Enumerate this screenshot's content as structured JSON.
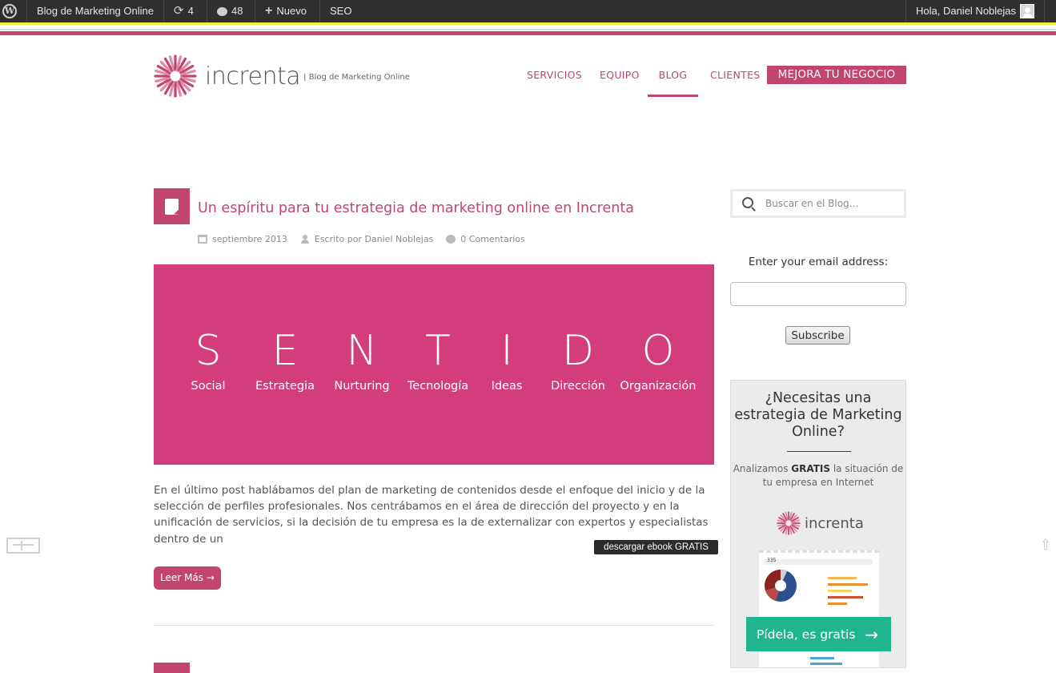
{
  "adminbar": {
    "site_name": "Blog de Marketing Online",
    "updates_count": "4",
    "comments_count": "48",
    "new_label": "Nuevo",
    "seo_label": "SEO",
    "greeting": "Hola, Daniel Noblejas",
    "wp_glyph": "W",
    "update_glyph": "⟳",
    "comment_glyph": "💬",
    "plus_glyph": "+"
  },
  "header": {
    "logo_text": "increnta",
    "tagline": "| Blog de Marketing Online",
    "nav": [
      "SERVICIOS",
      "EQUIPO",
      "BLOG",
      "CLIENTES"
    ],
    "cta": "MEJORA TU NEGOCIO",
    "accent": "#c2456f"
  },
  "post": {
    "title": "Un espíritu para tu estrategia de marketing online en Increnta",
    "date": "septiembre 2013",
    "author": "Escrito por Daniel Noblejas",
    "comments": "0 Comentarios",
    "hero_color": "#d33d7b",
    "hero_letters": [
      "S",
      "E",
      "N",
      "T",
      "I",
      "D",
      "O"
    ],
    "hero_words": [
      "Social",
      "Estrategia",
      "Nurturing",
      "Tecnología",
      "Ideas",
      "Dirección",
      "Organización"
    ],
    "excerpt": "En el último post hablábamos del plan de marketing de contenidos desde el enfoque del inicio y de la selección de perfiles profesionales. Nos centrábamos en el área de dirección del proyecto y en la unificación de servicios, si la decisión de tu empresa es la de externalizar con expertos y especialistas dentro de un",
    "read_more": "Leer Más →",
    "ebook_tooltip": "descargar ebook GRATIS"
  },
  "sidebar": {
    "search_placeholder": "Buscar en el Blog…",
    "email_label": "Enter your email address:",
    "subscribe_label": "Subscribe",
    "ad": {
      "title": "¿Necesitas una estrategia de Marketing Online?",
      "text_before": "Analizamos ",
      "text_bold": "GRATIS",
      "text_after": " la situación de tu empresa en Internet",
      "logo_text": "increnta",
      "shot_number": "335",
      "cta": "Pídela, es gratis",
      "cta_color": "#1fb58f"
    }
  },
  "floating": {
    "scroll_top_glyph": "⇧"
  }
}
